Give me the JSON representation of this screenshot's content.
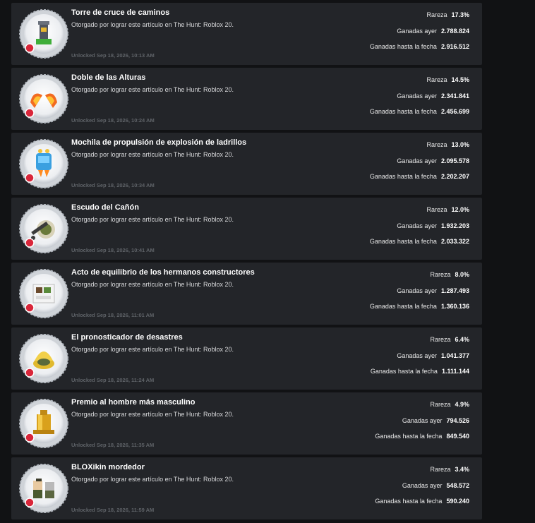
{
  "labels": {
    "rarity": "Rareza",
    "yesterday": "Ganadas ayer",
    "to_date": "Ganadas hasta la fecha"
  },
  "colors": {
    "card_bg": "#232529",
    "page_bg": "#111214",
    "unlock_text": "#5f6368",
    "badge_ring": "#c9cdd2",
    "badge_corner": "#d9263a"
  },
  "badges": [
    {
      "title": "Torre de cruce de caminos",
      "description": "Otorgado por lograr este artículo en The Hunt: Roblox 20.",
      "unlocked": "Unlocked Sep 18, 2026, 10:13 AM",
      "rarity": "17.3%",
      "yesterday": "2.788.824",
      "to_date": "2.916.512",
      "icon": "crossroads-tower-icon"
    },
    {
      "title": "Doble de las Alturas",
      "description": "Otorgado por lograr este artículo en The Hunt: Roblox 20.",
      "unlocked": "Unlocked Sep 18, 2026, 10:24 AM",
      "rarity": "14.5%",
      "yesterday": "2.341.841",
      "to_date": "2.456.699",
      "icon": "fire-wings-icon"
    },
    {
      "title": "Mochila de propulsión de explosión de ladrillos",
      "description": "Otorgado por lograr este artículo en The Hunt: Roblox 20.",
      "unlocked": "Unlocked Sep 18, 2026, 10:34 AM",
      "rarity": "13.0%",
      "yesterday": "2.095.578",
      "to_date": "2.202.207",
      "icon": "jetpack-icon"
    },
    {
      "title": "Escudo del Cañón",
      "description": "Otorgado por lograr este artículo en The Hunt: Roblox 20.",
      "unlocked": "Unlocked Sep 18, 2026, 10:41 AM",
      "rarity": "12.0%",
      "yesterday": "1.932.203",
      "to_date": "2.033.322",
      "icon": "cannon-shield-icon"
    },
    {
      "title": "Acto de equilibrio de los hermanos constructores",
      "description": "Otorgado por lograr este artículo en The Hunt: Roblox 20.",
      "unlocked": "Unlocked Sep 18, 2026, 11:01 AM",
      "rarity": "8.0%",
      "yesterday": "1.287.493",
      "to_date": "1.360.136",
      "icon": "balance-act-icon"
    },
    {
      "title": "El pronosticador de desastres",
      "description": "Otorgado por lograr este artículo en The Hunt: Roblox 20.",
      "unlocked": "Unlocked Sep 18, 2026, 11:24 AM",
      "rarity": "6.4%",
      "yesterday": "1.041.377",
      "to_date": "1.111.144",
      "icon": "disaster-forecaster-icon"
    },
    {
      "title": "Premio al hombre más masculino",
      "description": "Otorgado por lograr este artículo en The Hunt: Roblox 20.",
      "unlocked": "Unlocked Sep 18, 2026, 11:35 AM",
      "rarity": "4.9%",
      "yesterday": "794.526",
      "to_date": "849.540",
      "icon": "gold-trophy-icon"
    },
    {
      "title": "BLOXikin mordedor",
      "description": "Otorgado por lograr este artículo en The Hunt: Roblox 20.",
      "unlocked": "Unlocked Sep 18, 2026, 11:59 AM",
      "rarity": "3.4%",
      "yesterday": "548.572",
      "to_date": "590.240",
      "icon": "bloxikin-icon"
    }
  ]
}
